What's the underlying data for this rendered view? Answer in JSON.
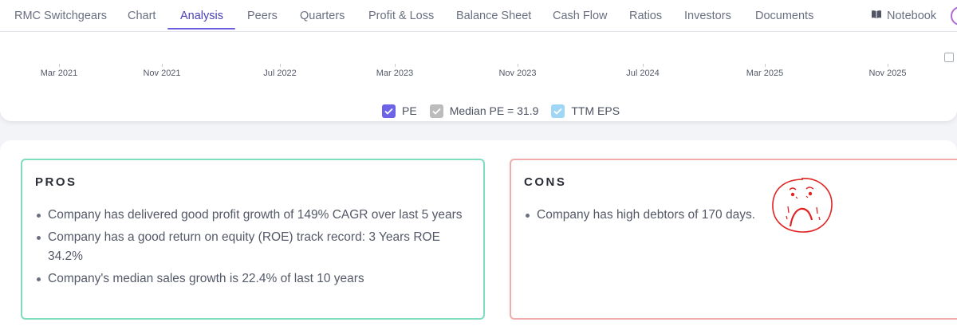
{
  "nav": {
    "tabs": [
      {
        "label": "RMC Switchgears",
        "active": false
      },
      {
        "label": "Chart",
        "active": false
      },
      {
        "label": "Analysis",
        "active": true
      },
      {
        "label": "Peers",
        "active": false
      },
      {
        "label": "Quarters",
        "active": false
      },
      {
        "label": "Profit & Loss",
        "active": false
      },
      {
        "label": "Balance Sheet",
        "active": false
      },
      {
        "label": "Cash Flow",
        "active": false
      },
      {
        "label": "Ratios",
        "active": false
      },
      {
        "label": "Investors",
        "active": false
      },
      {
        "label": "Documents",
        "active": false
      }
    ],
    "notebook_label": "Notebook",
    "accent_color": "#4a3fb6"
  },
  "chart": {
    "x_ticks": [
      "Mar 2021",
      "Nov 2021",
      "Jul 2022",
      "Mar 2023",
      "Nov 2023",
      "Jul 2024",
      "Mar 2025",
      "Nov 2025"
    ],
    "legend": [
      {
        "label": "PE",
        "checked": true,
        "color": "#6c63e6"
      },
      {
        "label": "Median PE = 31.9",
        "checked": true,
        "color": "#bcbcbc"
      },
      {
        "label": "TTM EPS",
        "checked": true,
        "color": "#9fd6f5"
      }
    ]
  },
  "analysis": {
    "pros": {
      "title": "PROS",
      "items": [
        "Company has delivered good profit growth of 149% CAGR over last 5 years",
        "Company has a good return on equity (ROE) track record: 3 Years ROE 34.2%",
        "Company's median sales growth is 22.4% of last 10 years"
      ],
      "border_color": "#7fdcc0"
    },
    "cons": {
      "title": "CONS",
      "items": [
        "Company has high debtors of 170 days."
      ],
      "border_color": "#f3aaaa"
    }
  }
}
